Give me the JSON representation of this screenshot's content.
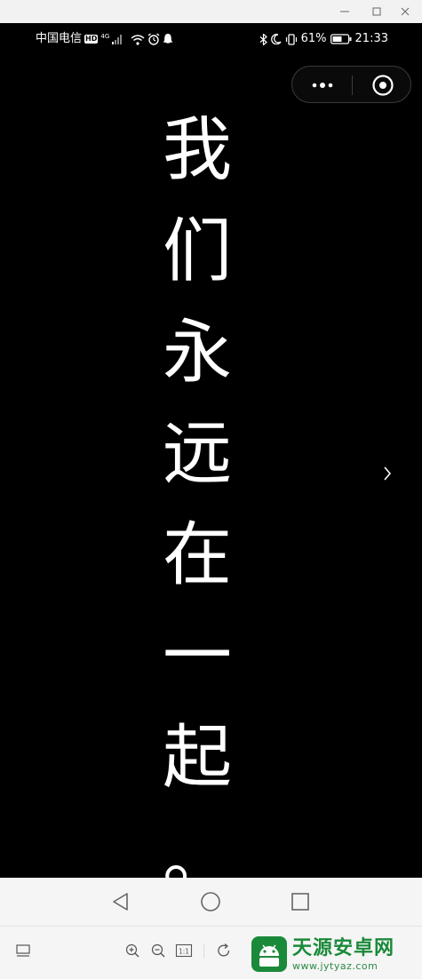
{
  "window": {
    "controls": [
      "minimize",
      "maximize",
      "close"
    ]
  },
  "status_bar": {
    "carrier": "中国电信",
    "hd_badge": "HD",
    "network_tag": "4G",
    "battery_percent": "61%",
    "time": "21:33",
    "icons": [
      "signal-icon",
      "wifi-icon",
      "alarm-icon",
      "qq-icon",
      "bluetooth-icon",
      "moon-icon",
      "vibrate-icon",
      "battery-icon"
    ]
  },
  "capsule": {
    "more_icon": "more-dots-icon",
    "target_icon": "target-circle-icon"
  },
  "poem": {
    "chars": [
      "我",
      "们",
      "永",
      "远",
      "在",
      "一",
      "起",
      "。"
    ]
  },
  "page_nav": {
    "next_icon": "chevron-right-icon"
  },
  "nav_bar": {
    "buttons": [
      "back-triangle-icon",
      "home-circle-icon",
      "recent-square-icon"
    ]
  },
  "toolbar": {
    "actual_size_label": "1:1",
    "icons": [
      "screen-icon",
      "zoom-in-icon",
      "zoom-out-icon",
      "actual-size-icon",
      "rotate-icon"
    ]
  },
  "watermark": {
    "title": "天源安卓网",
    "url": "www.jytyaz.com"
  },
  "colors": {
    "screen_bg": "#000000",
    "text": "#ffffff",
    "brand_green": "#1a8a3a"
  }
}
